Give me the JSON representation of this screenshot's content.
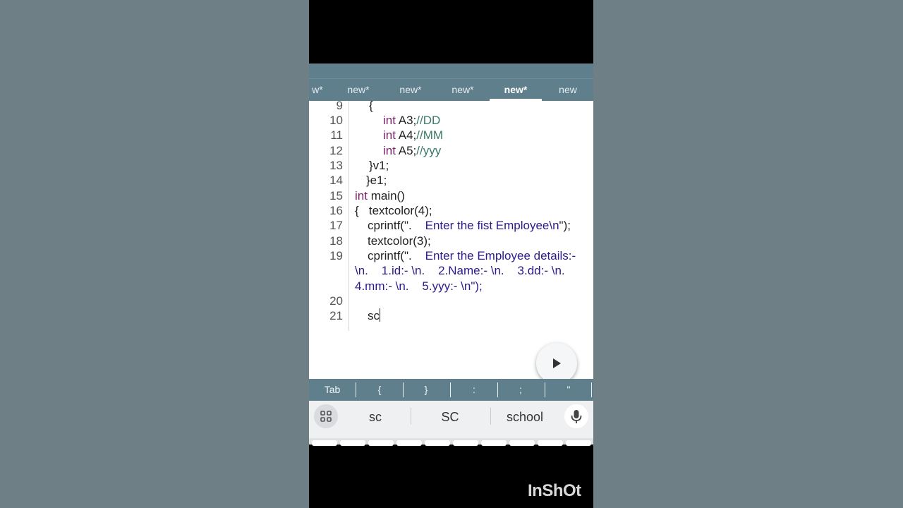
{
  "tabs": [
    {
      "label": "w*",
      "active": false
    },
    {
      "label": "new*",
      "active": false
    },
    {
      "label": "new*",
      "active": false
    },
    {
      "label": "new*",
      "active": false
    },
    {
      "label": "new*",
      "active": true
    },
    {
      "label": "new",
      "active": false
    }
  ],
  "editor": {
    "line_numbers": [
      "9",
      "10",
      "11",
      "12",
      "13",
      "14",
      "15",
      "16",
      "17",
      "18",
      "19",
      "20",
      "21"
    ],
    "lines": {
      "l9": "{",
      "l10_kw": "int",
      "l10_code": " A3;",
      "l10_cm": "//DD",
      "l11_kw": "int",
      "l11_code": " A4;",
      "l11_cm": "//MM",
      "l12_kw": "int",
      "l12_code": " A5;",
      "l12_cm": "//yyy",
      "l13": "}v1;",
      "l14": "}e1;",
      "l15_kw": "int",
      "l15_code": " main()",
      "l16": "{   textcolor(4);",
      "l17_a": "cprintf(\".",
      "l17_str": "    Enter the fist Employee\\n",
      "l17_b": "\");",
      "l18": "textcolor(3);",
      "l19_a": "cprintf(\".",
      "l19_str": "    Enter the Employee details:-",
      "l19_w1": "\\n.    1.id:- \\n.    2.Name:- \\n.    3.dd:- \\n.",
      "l19_w2": "4.mm:- \\n.    5.yyy:- \\n\");",
      "l20": "",
      "l21": "sc"
    }
  },
  "run_button": {
    "icon": "play-icon"
  },
  "symbol_bar": [
    "Tab",
    "{",
    "}",
    ":",
    ";",
    "\""
  ],
  "suggestions": [
    "sc",
    "SC",
    "school"
  ],
  "watermark": "InShOt",
  "colors": {
    "toolbar": "#5f7f8c",
    "keyword": "#7a1f6a",
    "comment": "#3a7a6a",
    "string": "#2b1b8c",
    "background": "#6e7f86"
  }
}
